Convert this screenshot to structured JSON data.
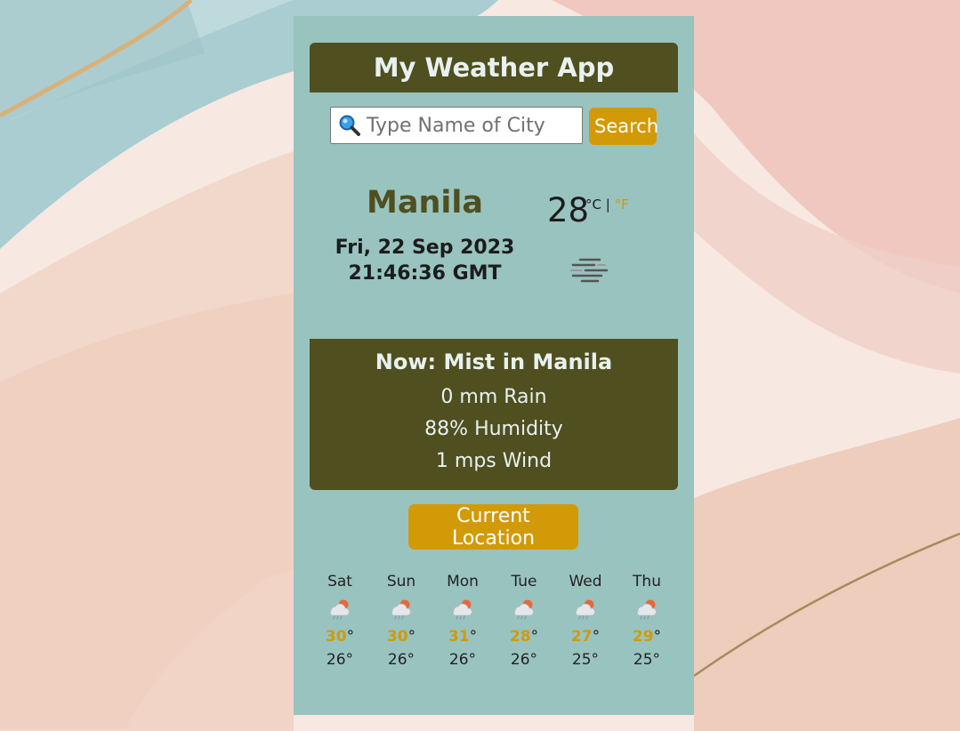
{
  "app": {
    "title": "My Weather App"
  },
  "search": {
    "placeholder": "Type Name of City",
    "button_label": "Search"
  },
  "current": {
    "city": "Manila",
    "date": "Fri, 22 Sep 2023",
    "time": "21:46:36 GMT",
    "temperature": "28",
    "unit_c": "°C",
    "unit_separator": "|",
    "unit_f": "°F",
    "icon": "mist-icon"
  },
  "now": {
    "title": "Now: Mist in Manila",
    "rain": "0 mm Rain",
    "humidity": "88% Humidity",
    "wind": "1 mps Wind"
  },
  "location_button": "Current Location",
  "forecast": [
    {
      "day": "Sat",
      "hi": "30",
      "lo": "26°",
      "icon": "rain-sun-icon"
    },
    {
      "day": "Sun",
      "hi": "30",
      "lo": "26°",
      "icon": "rain-sun-icon"
    },
    {
      "day": "Mon",
      "hi": "31",
      "lo": "26°",
      "icon": "rain-sun-icon"
    },
    {
      "day": "Tue",
      "hi": "28",
      "lo": "26°",
      "icon": "rain-sun-icon"
    },
    {
      "day": "Wed",
      "hi": "27",
      "lo": "25°",
      "icon": "rain-sun-icon"
    },
    {
      "day": "Thu",
      "hi": "29",
      "lo": "25°",
      "icon": "rain-sun-icon"
    }
  ],
  "colors": {
    "card": "#99c3bf",
    "panel": "#4f4f1f",
    "accent": "#d39a07"
  }
}
